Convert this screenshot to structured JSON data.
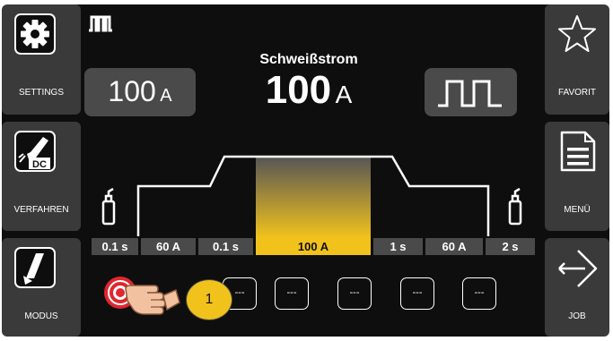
{
  "left_sidebar": [
    {
      "label": "SETTINGS",
      "icon": "gear-icon"
    },
    {
      "label": "VERFAHREN",
      "icon": "dc-torch-icon",
      "badge": "DC"
    },
    {
      "label": "MODUS",
      "icon": "torch-trigger-icon"
    }
  ],
  "right_sidebar": [
    {
      "label": "FAVORIT",
      "icon": "star-icon"
    },
    {
      "label": "MENÜ",
      "icon": "menu-document-icon"
    },
    {
      "label": "JOB",
      "icon": "job-arrow-icon"
    }
  ],
  "header": {
    "pulse_icon": "pulse-mode-icon",
    "title": "Schweißstrom",
    "main_value": "100",
    "main_unit": "A",
    "left_value": "100",
    "left_unit": "A",
    "waveform_icon": "square-wave-icon"
  },
  "sequence": {
    "segments": [
      "0.1 s",
      "60 A",
      "0.1 s",
      "100 A",
      "1 s",
      "60 A",
      "2 s"
    ],
    "active_index": 3,
    "gas_icon": "gas-bottle-icon"
  },
  "favorites": {
    "slots": [
      "---",
      "---",
      "---",
      "---",
      "---",
      "---"
    ],
    "callout_number": "1"
  },
  "colors": {
    "accent": "#f2c21c",
    "record": "#e0262e",
    "panel": "#4a4a4a",
    "background": "#0e0e0e"
  }
}
